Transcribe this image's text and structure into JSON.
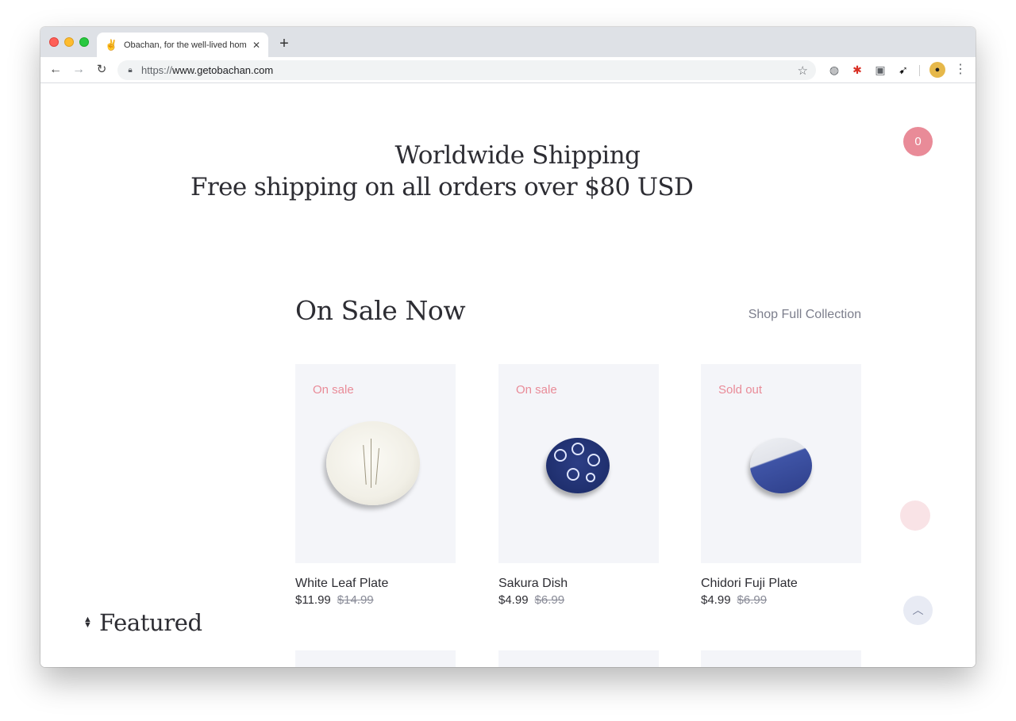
{
  "browser": {
    "tab_title": "Obachan, for the well-lived hom",
    "tab_favicon": "peace-hand-icon",
    "new_tab": "+",
    "url_scheme": "https://",
    "url_host": "www.getobachan.com"
  },
  "announcement": {
    "title": "Worldwide Shipping",
    "subtitle": "Free shipping on all orders over $80 USD"
  },
  "cart": {
    "count": "0"
  },
  "sale_section": {
    "title": "On Sale Now",
    "shop_link": "Shop Full Collection",
    "products": [
      {
        "badge": "On sale",
        "name": "White Leaf Plate",
        "price": "$11.99",
        "old_price": "$14.99"
      },
      {
        "badge": "On sale",
        "name": "Sakura Dish",
        "price": "$4.99",
        "old_price": "$6.99"
      },
      {
        "badge": "Sold out",
        "name": "Chidori Fuji Plate",
        "price": "$4.99",
        "old_price": "$6.99"
      }
    ]
  },
  "sort": {
    "label": "Featured"
  },
  "colors": {
    "accent_pink": "#e98b98",
    "card_bg": "#f4f5f9",
    "text_dark": "#2d2d33"
  }
}
